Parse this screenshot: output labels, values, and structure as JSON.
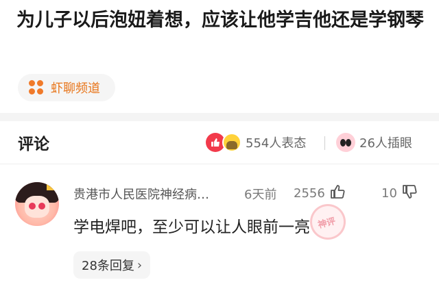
{
  "article": {
    "title": "为儿子以后泡妞着想，应该让他学吉他还是学钢琴"
  },
  "channel": {
    "label": "虾聊频道"
  },
  "comments_header": {
    "heading": "评论",
    "reaction_1_text": "554人表态",
    "reaction_2_text": "26人插眼"
  },
  "comment": {
    "author": "贵港市人民医院神经病…",
    "time": "6天前",
    "likes": "2556",
    "dislikes": "10",
    "body": "学电焊吧，至少可以让人眼前一亮",
    "replies_label": "28条回复",
    "replies_chevron": "›"
  },
  "colors": {
    "accent": "#e8751a",
    "like_red": "#f23a4b"
  }
}
